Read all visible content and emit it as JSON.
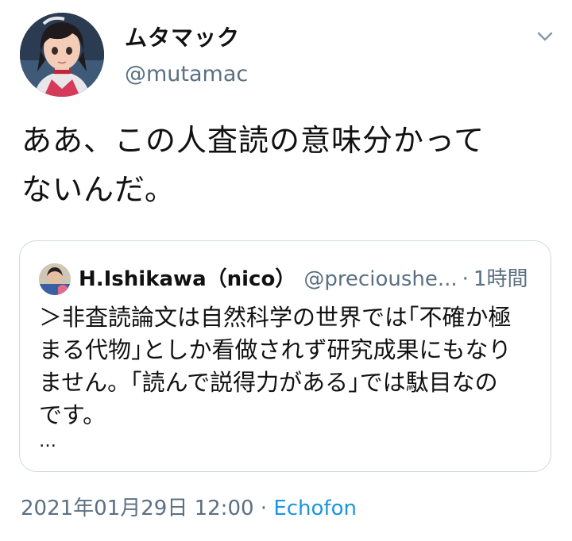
{
  "author": {
    "display_name": "ムタマック",
    "handle": "@mutamac",
    "avatar_icon": "anime-girl-avatar"
  },
  "tweet": {
    "text_line1": "ああ、この人査読の意味分かって",
    "text_line2": "ないんだ。"
  },
  "quote": {
    "author_name": "H.Ishikawa（nico）",
    "author_handle": "@precioushe...",
    "separator": "·",
    "time": "1時間",
    "lines": [
      "＞非査読論文は自然科学の世界では｢不確か極",
      "まる代物｣としか看做されず研究成果にもなり",
      "ません。｢読んで説得力がある｣では駄目なの",
      "です。"
    ],
    "ellipsis": "…"
  },
  "meta": {
    "datetime": "2021年01月29日 12:00",
    "separator": "·",
    "source": "Echofon"
  },
  "colors": {
    "secondary_text": "#5b7083",
    "link": "#1b95e0",
    "border": "#cfd9de"
  }
}
